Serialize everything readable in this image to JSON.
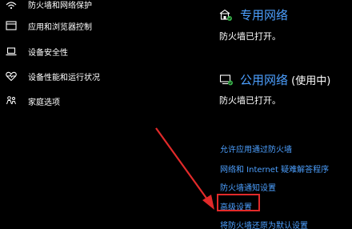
{
  "sidebar": {
    "items": [
      {
        "label": "防火墙和网络保护",
        "icon": "wifi-icon"
      },
      {
        "label": "应用和浏览器控制",
        "icon": "app-window-icon"
      },
      {
        "label": "设备安全性",
        "icon": "laptop-icon"
      },
      {
        "label": "设备性能和运行状况",
        "icon": "heart-icon"
      },
      {
        "label": "家庭选项",
        "icon": "family-icon"
      }
    ]
  },
  "networks": [
    {
      "name": "专用网络",
      "suffix": "",
      "status": "防火墙已打开。",
      "icon": "private-network-icon"
    },
    {
      "name": "公用网络",
      "suffix": " (使用中)",
      "status": "防火墙已打开。",
      "icon": "public-network-icon"
    }
  ],
  "links": [
    "允许应用通过防火墙",
    "网络和 Internet 疑难解答程序",
    "防火墙通知设置",
    "高级设置",
    "将防火墙还原为默认设置"
  ],
  "colors": {
    "background": "#000000",
    "link": "#4c9ffe",
    "annotation": "#e22a2a",
    "icon_green": "#38b24a"
  }
}
